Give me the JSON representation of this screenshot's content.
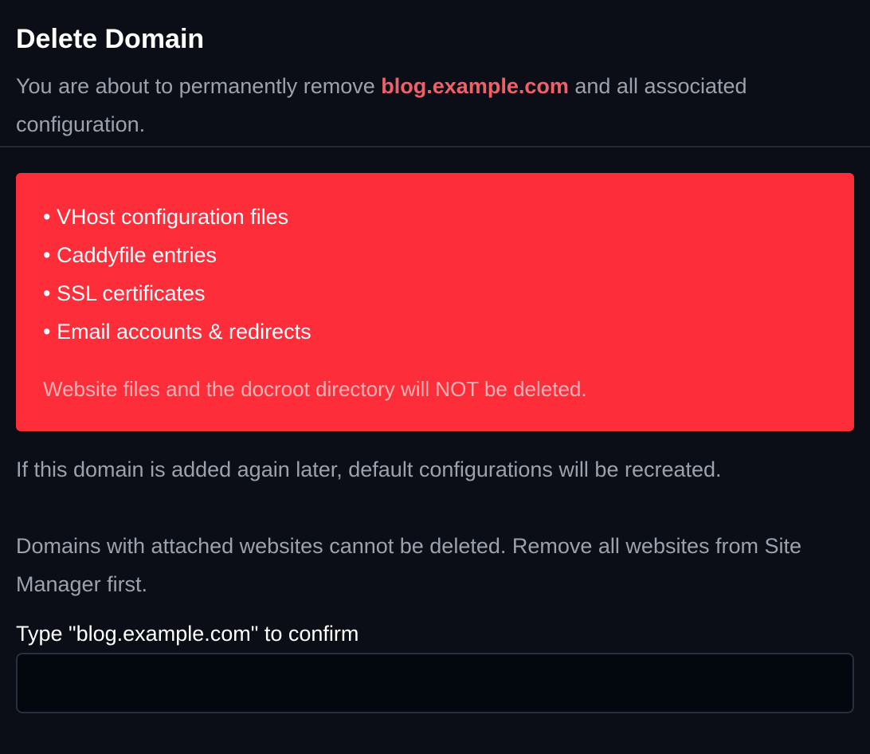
{
  "dialog": {
    "title": "Delete Domain",
    "description_prefix": "You are about to permanently remove ",
    "domain": "blog.example.com",
    "description_suffix": " and all associated configuration."
  },
  "alert": {
    "items": [
      "• VHost configuration files",
      "• Caddyfile entries",
      "• SSL certificates",
      "• Email accounts & redirects"
    ],
    "note": "Website files and the docroot directory will NOT be deleted."
  },
  "info": {
    "recreate_text": "If this domain is added again later, default configurations will be recreated.",
    "attached_text": "Domains with attached websites cannot be deleted. Remove all websites from Site Manager first."
  },
  "confirm": {
    "label": "Type \"blog.example.com\" to confirm",
    "value": "",
    "placeholder": ""
  },
  "colors": {
    "background": "#0b0e16",
    "danger": "#fe2d3a",
    "domain_highlight": "#f0606a",
    "muted_text": "#9ba1ad"
  }
}
